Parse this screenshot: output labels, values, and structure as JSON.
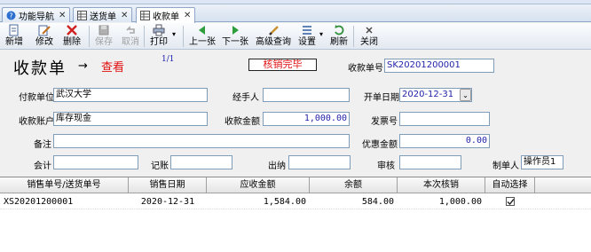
{
  "tabs": [
    {
      "label": "功能导航",
      "icon": "help-circle-icon"
    },
    {
      "label": "送货单",
      "icon": "grid-icon"
    },
    {
      "label": "收款单",
      "icon": "grid-icon"
    }
  ],
  "toolbar": {
    "new": "新增",
    "edit": "修改",
    "delete": "删除",
    "save": "保存",
    "cancel": "取消",
    "print": "打印",
    "prev": "上一张",
    "next": "下一张",
    "query": "高级查询",
    "settings": "设置",
    "refresh": "刷新",
    "close": "关闭"
  },
  "form": {
    "title": "收款单",
    "arrow": "→",
    "mode": "查看",
    "pager": "1/1",
    "stamp": "核销完毕",
    "doc_no_label": "收款单号",
    "doc_no": "SK20201200001",
    "payer_label": "付款单位",
    "payer": "武汉大学",
    "handler_label": "经手人",
    "handler": "",
    "date_label": "开单日期",
    "date": "2020-12-31",
    "account_label": "收款账户",
    "account": "库存现金",
    "amount_label": "收款金额",
    "amount": "1,000.00",
    "invoice_label": "发票号",
    "invoice": "",
    "remark_label": "备注",
    "remark": "",
    "discount_label": "优惠金额",
    "discount": "0.00",
    "accountant_label": "会计",
    "accountant": "",
    "bookkeeper_label": "记账",
    "bookkeeper": "",
    "cashier_label": "出纳",
    "cashier": "",
    "auditor_label": "审核",
    "auditor": "",
    "maker_label": "制单人",
    "maker": "操作员1"
  },
  "grid": {
    "headers": [
      "销售单号/送货单号",
      "销售日期",
      "应收金额",
      "余额",
      "本次核销",
      "自动选择"
    ],
    "rows": [
      {
        "doc": "XS20201200001",
        "date": "2020-12-31",
        "receivable": "1,584.00",
        "balance": "584.00",
        "writeoff": "1,000.00",
        "auto": true
      }
    ]
  },
  "colors": {
    "accent_red": "#e01010",
    "number_blue": "#1f1fa8",
    "border": "#7f9db9"
  }
}
